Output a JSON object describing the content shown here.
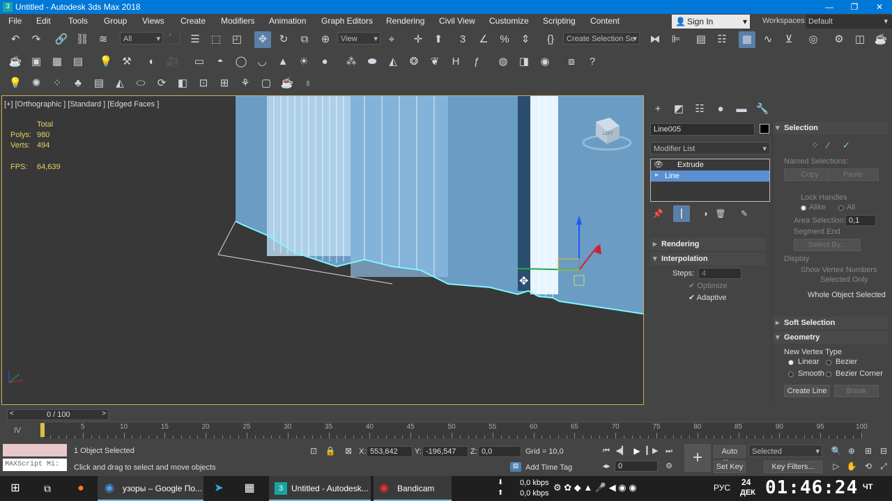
{
  "window": {
    "title": "Untitled - Autodesk 3ds Max 2018",
    "app_icon_text": "3"
  },
  "menu": [
    "File",
    "Edit",
    "Tools",
    "Group",
    "Views",
    "Create",
    "Modifiers",
    "Animation",
    "Graph Editors",
    "Rendering",
    "Civil View",
    "Customize",
    "Scripting",
    "Content"
  ],
  "header": {
    "sign_in": "Sign In",
    "workspaces_label": "Workspaces:",
    "workspace": "Default"
  },
  "toolbar": {
    "filter": "All",
    "view": "View",
    "selection_set": "Create Selection Se"
  },
  "viewport": {
    "label": "[+] [Orthographic ] [Standard ] [Edged Faces ]",
    "stats": {
      "total_label": "Total",
      "polys_label": "Polys:",
      "polys": "980",
      "verts_label": "Verts:",
      "verts": "494",
      "fps_label": "FPS:",
      "fps": "64,639"
    },
    "viewcube_text": "LEFT"
  },
  "command_panel": {
    "object_name": "Line005",
    "modifier_list": "Modifier List",
    "stack": [
      "Extrude",
      "Line"
    ],
    "selected_stack_item": "Line",
    "rollouts": {
      "rendering": "Rendering",
      "interpolation": "Interpolation",
      "selection": "Selection",
      "soft_selection": "Soft Selection",
      "geometry": "Geometry"
    },
    "interpolation": {
      "steps_label": "Steps:",
      "steps": "4",
      "optimize": "Optimize",
      "adaptive": "Adaptive"
    },
    "selection": {
      "named_selections": "Named Selections:",
      "copy": "Copy",
      "paste": "Paste",
      "lock_handles": "Lock Handles",
      "alike": "Alike",
      "all": "All",
      "area_selection": "Area Selection:",
      "area_value": "0,1",
      "segment_end": "Segment End",
      "select_by": "Select By...",
      "display": "Display",
      "show_vertex_numbers": "Show Vertex Numbers",
      "selected_only": "Selected Only",
      "status": "Whole Object Selected"
    },
    "geometry": {
      "new_vertex_type": "New Vertex Type",
      "linear": "Linear",
      "bezier": "Bezier",
      "smooth": "Smooth",
      "bezier_corner": "Bezier Corner",
      "create_line": "Create Line",
      "break": "Break"
    }
  },
  "timeline": {
    "frame": "0 / 100",
    "ticks": [
      "0",
      "5",
      "10",
      "15",
      "20",
      "25",
      "30",
      "35",
      "40",
      "45",
      "50",
      "55",
      "60",
      "65",
      "70",
      "75",
      "80",
      "85",
      "90",
      "95",
      "100"
    ]
  },
  "status": {
    "maxscript": "MAXScript Mi:",
    "selected": "1 Object Selected",
    "prompt": "Click and drag to select and move objects",
    "x_label": "X:",
    "x": "553,642",
    "y_label": "Y:",
    "y": "-196,547",
    "z_label": "Z:",
    "z": "0,0",
    "grid": "Grid = 10,0",
    "add_time_tag": "Add Time Tag",
    "auto_key": "Auto Key",
    "set_key": "Set Key",
    "key_mode": "Selected",
    "key_filters": "Key Filters...",
    "frame_field": "0"
  },
  "taskbar": {
    "chrome": "узоры – Google По...",
    "max": "Untitled - Autodesk...",
    "bandicam": "Bandicam",
    "net_down": "0,0 kbps",
    "net_up": "0,0 kbps",
    "lang": "РУС",
    "day": "24",
    "month": "ДЕК",
    "time": "01:46:24",
    "weekday": "ЧТ"
  }
}
